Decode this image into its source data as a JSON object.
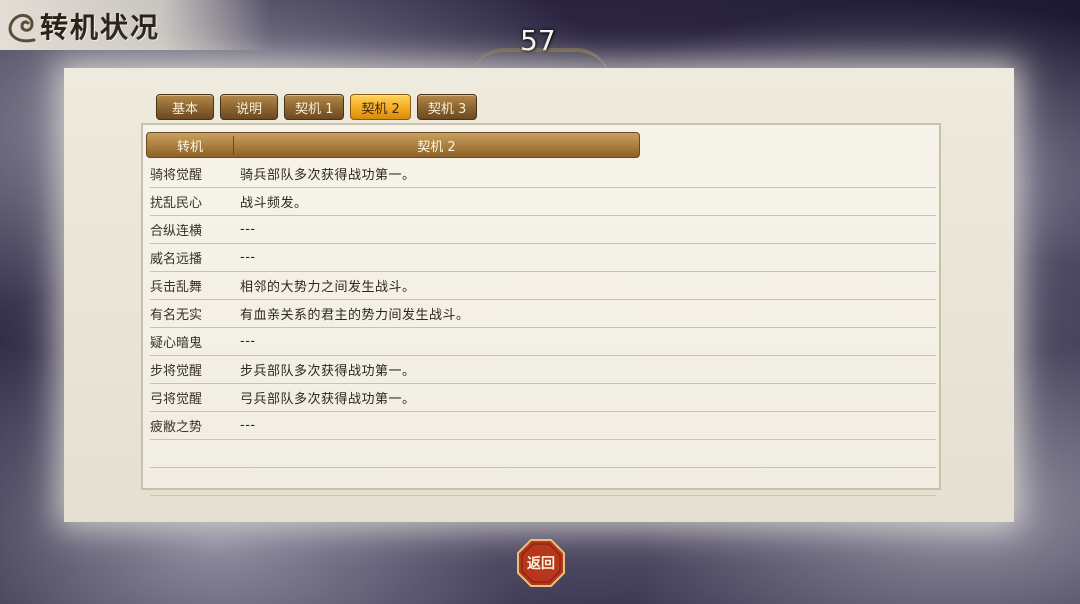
{
  "header": {
    "title": "转机状况",
    "timer": "57"
  },
  "tabs": [
    {
      "label": "基本",
      "active": false
    },
    {
      "label": "说明",
      "active": false
    },
    {
      "label": "契机 1",
      "active": false
    },
    {
      "label": "契机 2",
      "active": true
    },
    {
      "label": "契机 3",
      "active": false
    }
  ],
  "table": {
    "col_event": "转机",
    "col_trigger": "契机 2",
    "rows": [
      {
        "name": "骑将觉醒",
        "desc": "骑兵部队多次获得战功第一。"
      },
      {
        "name": "扰乱民心",
        "desc": "战斗频发。"
      },
      {
        "name": "合纵连横",
        "desc": "---"
      },
      {
        "name": "威名远播",
        "desc": "---"
      },
      {
        "name": "兵击乱舞",
        "desc": "相邻的大势力之间发生战斗。"
      },
      {
        "name": "有名无实",
        "desc": "有血亲关系的君主的势力间发生战斗。"
      },
      {
        "name": "疑心暗鬼",
        "desc": "---"
      },
      {
        "name": "步将觉醒",
        "desc": "步兵部队多次获得战功第一。"
      },
      {
        "name": "弓将觉醒",
        "desc": "弓兵部队多次获得战功第一。"
      },
      {
        "name": "疲敝之势",
        "desc": "---"
      },
      {
        "name": "",
        "desc": ""
      },
      {
        "name": "",
        "desc": ""
      }
    ]
  },
  "footer": {
    "return_label": "返回"
  },
  "colors": {
    "tab_active": "#f2a71e",
    "tab_inactive": "#8a6330",
    "return_button": "#b8361e"
  }
}
